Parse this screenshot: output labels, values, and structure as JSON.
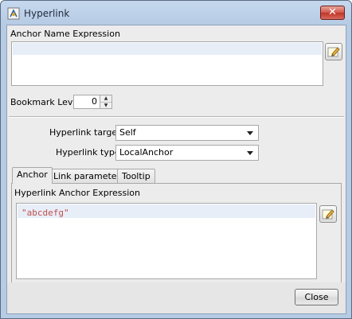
{
  "window": {
    "title": "Hyperlink",
    "close_glyph": "✕"
  },
  "anchor_name": {
    "label": "Anchor Name Expression",
    "value": ""
  },
  "bookmark": {
    "label": "Bookmark Level",
    "value": "0"
  },
  "hyperlink_target": {
    "label": "Hyperlink target",
    "selected": "Self"
  },
  "hyperlink_type": {
    "label": "Hyperlink type",
    "selected": "LocalAnchor"
  },
  "tabs": [
    {
      "label": "Anchor",
      "active": true
    },
    {
      "label": "Link parameters",
      "active": false
    },
    {
      "label": "Tooltip",
      "active": false
    }
  ],
  "anchor_tab": {
    "label": "Hyperlink Anchor Expression",
    "expression": "\"abcdefg\""
  },
  "buttons": {
    "close": "Close"
  },
  "icons": {
    "title": "hyperlink-app-icon",
    "edit_expression": "pencil-edit-icon",
    "dropdown": "chevron-down-icon",
    "spinner_up": "arrow-up-icon",
    "spinner_down": "arrow-down-icon"
  },
  "colors": {
    "expression_text": "#c0504d",
    "close_button": "#c03528"
  }
}
